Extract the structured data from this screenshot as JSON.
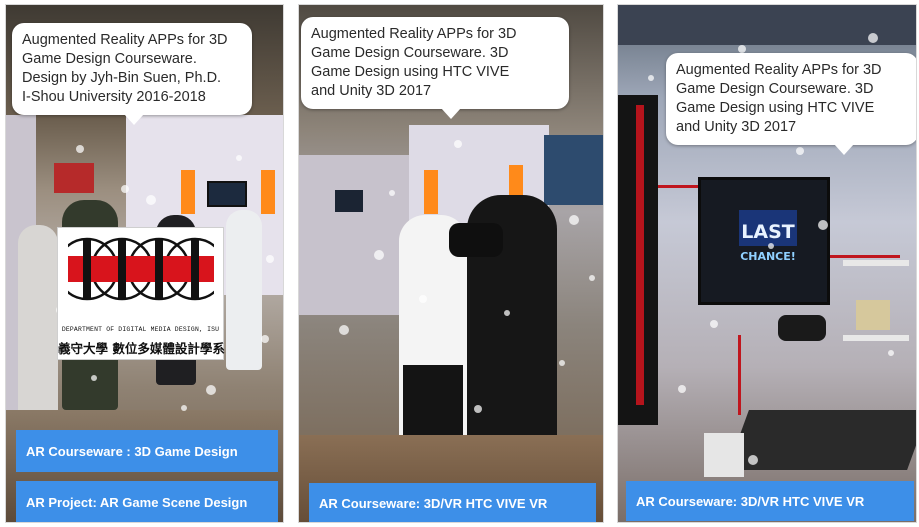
{
  "screens": [
    {
      "bubble_lines": [
        "Augmented Reality APPs for 3D",
        "Game Design Courseware.",
        "Design by Jyh-Bin Suen, Ph.D.",
        "I-Shou University 2016-2018"
      ],
      "buttons": [
        "AR Courseware : 3D Game Design",
        "AR Project: AR Game Scene Design"
      ],
      "logo": {
        "department": "DEPARTMENT OF DIGITAL MEDIA DESIGN, ISU",
        "chinese": "義守大學 數位多媒體設計學系"
      }
    },
    {
      "bubble_lines": [
        "Augmented Reality APPs for 3D",
        "Game Design Courseware. 3D",
        "Game Design using HTC VIVE",
        "and Unity 3D 2017"
      ],
      "buttons": [
        "AR Courseware: 3D/VR HTC VIVE VR"
      ]
    },
    {
      "bubble_lines": [
        "Augmented Reality APPs for 3D",
        "Game Design Courseware. 3D",
        "Game Design using HTC VIVE",
        "and Unity 3D 2017"
      ],
      "buttons": [
        "AR Courseware: 3D/VR HTC VIVE VR"
      ],
      "vr_screen": {
        "line1": "LAST",
        "line2": "CHANCE!"
      }
    }
  ],
  "colors": {
    "button": "#3d8fe8",
    "logo_red": "#d8141c",
    "bubble": "#ffffff"
  }
}
